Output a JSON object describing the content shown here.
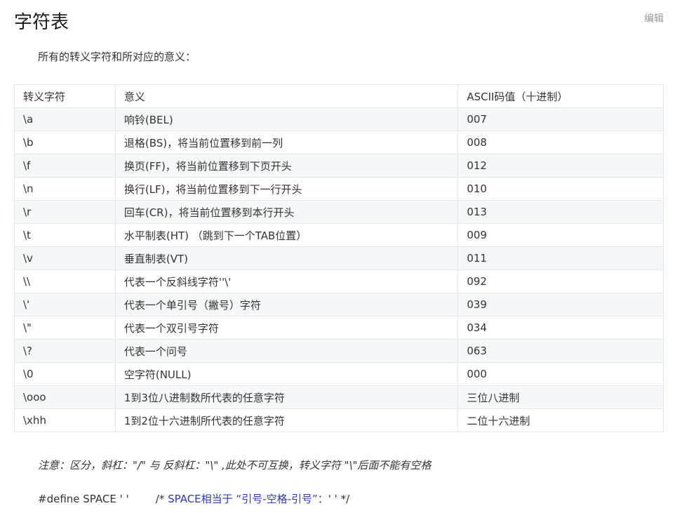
{
  "title": "字符表",
  "edit_label": "编辑",
  "intro": "所有的转义字符和所对应的意义：",
  "table": {
    "headers": [
      "转义字符",
      "意义",
      "ASCII码值（十进制）"
    ],
    "rows": [
      [
        "\\a",
        "响铃(BEL)",
        "007"
      ],
      [
        "\\b",
        "退格(BS)，将当前位置移到前一列",
        "008"
      ],
      [
        "\\f",
        "换页(FF)，将当前位置移到下页开头",
        "012"
      ],
      [
        "\\n",
        "换行(LF)，将当前位置移到下一行开头",
        "010"
      ],
      [
        "\\r",
        "回车(CR)，将当前位置移到本行开头",
        "013"
      ],
      [
        "\\t",
        "水平制表(HT) （跳到下一个TAB位置）",
        "009"
      ],
      [
        "\\v",
        "垂直制表(VT)",
        "011"
      ],
      [
        "\\\\",
        "代表一个反斜线字符''\\'",
        "092"
      ],
      [
        "\\'",
        "代表一个单引号（撇号）字符",
        "039"
      ],
      [
        "\\\"",
        "代表一个双引号字符",
        "034"
      ],
      [
        "\\?",
        "代表一个问号",
        "063"
      ],
      [
        "\\0",
        "空字符(NULL)",
        "000"
      ],
      [
        "\\ooo",
        "1到3位八进制数所代表的任意字符",
        "三位八进制"
      ],
      [
        "\\xhh",
        "1到2位十六进制所代表的任意字符",
        "二位十六进制"
      ]
    ]
  },
  "note": "注意：区分，斜杠：\"/\" 与 反斜杠：\"\\\" ,此处不可互换，转义字符 \"\\\"后面不能有空格",
  "code": {
    "define": "#define SPACE ' '",
    "comment_open": "/*",
    "comment_text": " SPACE相当于 “引号-空格-引号”：' ' ",
    "comment_close": "*/"
  },
  "colors": {
    "comment": "#2b3ab0",
    "row_stripe": "#f6f7f9",
    "border": "#e6e6e6"
  }
}
